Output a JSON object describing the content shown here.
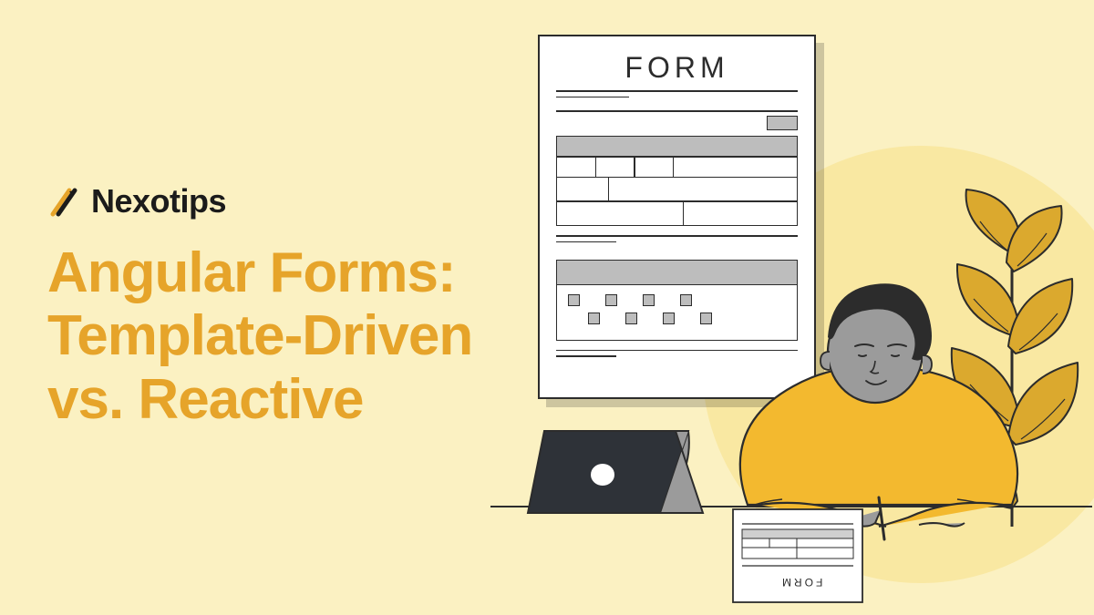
{
  "brand": {
    "name": "Nexotips"
  },
  "headline": {
    "line1": "Angular Forms:",
    "line2": "Template-Driven",
    "line3": "vs. Reactive"
  },
  "form_illustration": {
    "title": "FORM",
    "paper_label": "FORM"
  }
}
